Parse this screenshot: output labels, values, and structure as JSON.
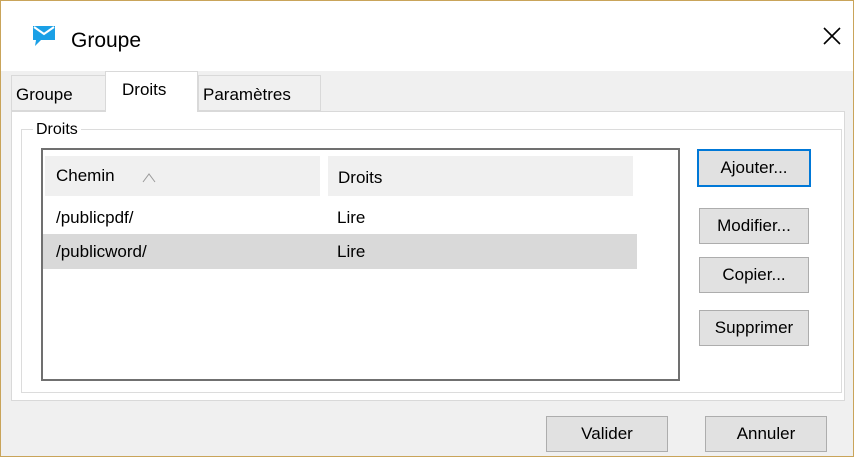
{
  "window": {
    "title": "Groupe"
  },
  "tabs": [
    {
      "label": "Groupe",
      "active": false
    },
    {
      "label": "Droits",
      "active": true
    },
    {
      "label": "Paramètres",
      "active": false
    }
  ],
  "group": {
    "legend": "Droits"
  },
  "list": {
    "columns": [
      "Chemin",
      "Droits"
    ],
    "sort_indicator": "ascending",
    "rows": [
      {
        "path": "/publicpdf/",
        "rights": "Lire",
        "selected": false
      },
      {
        "path": "/publicword/",
        "rights": "Lire",
        "selected": true
      }
    ]
  },
  "side_buttons": {
    "add": "Ajouter...",
    "edit": "Modifier...",
    "copy": "Copier...",
    "delete": "Supprimer"
  },
  "footer": {
    "ok": "Valider",
    "cancel": "Annuler"
  },
  "icons": {
    "app": "envelope-message-icon",
    "close": "close-icon",
    "sort": "sort-ascending-icon"
  },
  "colors": {
    "accent": "#0078d7",
    "app_icon": "#1aa0e6",
    "selection": "#d9d9d9"
  }
}
